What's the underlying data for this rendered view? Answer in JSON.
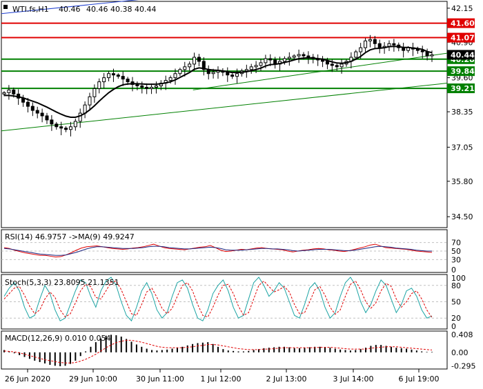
{
  "window": {
    "symbol_label": "WTI.fs,H1",
    "ohlc": [
      "40.46",
      "40.46",
      "40.38",
      "40.44"
    ]
  },
  "colors": {
    "background": "#ffffff",
    "border": "#000000",
    "bull_candle": "#ffffff",
    "bear_candle": "#000000",
    "wick": "#000000",
    "ma": "#000000",
    "resistance": "#e00000",
    "support": "#008000",
    "trendline_blue": "#1f3fcf",
    "trendline_green": "#008000",
    "rsi_line": "#1a237e",
    "rsi_ma": "#e00000",
    "stoch_main": "#1aa3a3",
    "stoch_signal": "#e00000",
    "macd_hist": "#000000",
    "macd_signal": "#e00000",
    "level_box_red": "#e00000",
    "level_box_green": "#008000",
    "current_price_box": "#000000"
  },
  "chart_data": {
    "type": "candlestick",
    "x_ticks": [
      "26 Jun 2020",
      "29 Jun 10:00",
      "30 Jun 11:00",
      "1 Jul 12:00",
      "2 Jul 13:00",
      "3 Jul 14:00",
      "6 Jul 19:00"
    ],
    "price_axis": {
      "ticks": [
        "42.15",
        "40.90",
        "39.60",
        "38.35",
        "37.05",
        "35.80",
        "34.50"
      ],
      "ylim": [
        34.1,
        42.4
      ]
    },
    "levels": [
      {
        "label": "41.60",
        "value": 41.6,
        "kind": "resistance"
      },
      {
        "label": "41.07",
        "value": 41.07,
        "kind": "resistance"
      },
      {
        "label": "40.28",
        "value": 40.28,
        "kind": "support"
      },
      {
        "label": "39.84",
        "value": 39.84,
        "kind": "support"
      },
      {
        "label": "39.21",
        "value": 39.21,
        "kind": "support"
      }
    ],
    "current_price": {
      "label": "40.44",
      "value": 40.44
    },
    "close": [
      39.05,
      39.15,
      39.0,
      38.85,
      38.7,
      38.55,
      38.4,
      38.3,
      38.2,
      38.05,
      37.9,
      37.8,
      37.75,
      37.7,
      37.8,
      38.0,
      38.3,
      38.6,
      38.9,
      39.2,
      39.45,
      39.6,
      39.75,
      39.7,
      39.65,
      39.55,
      39.45,
      39.35,
      39.3,
      39.25,
      39.2,
      39.25,
      39.3,
      39.4,
      39.5,
      39.6,
      39.75,
      39.9,
      40.0,
      40.1,
      40.35,
      40.2,
      39.9,
      39.75,
      39.8,
      39.85,
      39.8,
      39.7,
      39.65,
      39.75,
      39.85,
      39.9,
      40.0,
      40.05,
      40.15,
      40.3,
      40.25,
      40.1,
      40.2,
      40.3,
      40.35,
      40.4,
      40.45,
      40.4,
      40.35,
      40.3,
      40.25,
      40.2,
      40.1,
      40.05,
      40.0,
      40.1,
      40.2,
      40.35,
      40.55,
      40.7,
      40.95,
      41.0,
      40.85,
      40.7,
      40.75,
      40.85,
      40.8,
      40.7,
      40.6,
      40.7,
      40.65,
      40.6,
      40.55,
      40.4,
      40.44
    ],
    "ma_line": [
      38.95,
      38.95,
      38.93,
      38.9,
      38.86,
      38.8,
      38.74,
      38.68,
      38.6,
      38.52,
      38.43,
      38.34,
      38.26,
      38.19,
      38.15,
      38.15,
      38.2,
      38.29,
      38.42,
      38.57,
      38.74,
      38.9,
      39.05,
      39.17,
      39.27,
      39.34,
      39.37,
      39.38,
      39.38,
      39.37,
      39.36,
      39.36,
      39.36,
      39.38,
      39.41,
      39.45,
      39.52,
      39.61,
      39.7,
      39.79,
      39.91,
      39.96,
      39.94,
      39.9,
      39.88,
      39.87,
      39.85,
      39.82,
      39.79,
      39.79,
      39.8,
      39.82,
      39.86,
      39.9,
      39.95,
      40.03,
      40.08,
      40.09,
      40.12,
      40.16,
      40.2,
      40.25,
      40.3,
      40.32,
      40.33,
      40.32,
      40.3,
      40.28,
      40.23,
      40.18,
      40.14,
      40.13,
      40.15,
      40.2,
      40.28,
      40.38,
      40.52,
      40.62,
      40.67,
      40.68,
      40.7,
      40.74,
      40.75,
      40.74,
      40.71,
      40.71,
      40.69,
      40.67,
      40.64,
      40.56,
      40.52
    ],
    "trendlines": [
      {
        "color_key": "trendline_blue",
        "from": [
          0.0,
          41.95
        ],
        "to": [
          0.33,
          42.5
        ]
      },
      {
        "color_key": "trendline_green",
        "from": [
          0.0,
          37.65
        ],
        "to": [
          1.0,
          39.4
        ]
      },
      {
        "color_key": "trendline_green",
        "from": [
          0.43,
          39.15
        ],
        "to": [
          1.0,
          40.5
        ]
      }
    ],
    "rsi": {
      "label": "RSI(14) 46.9757  ->MA(9) 49.9247",
      "levels": [
        "70",
        "50",
        "30",
        "0"
      ],
      "ylim": [
        0,
        100
      ],
      "values": [
        58,
        56,
        52,
        49,
        46,
        44,
        42,
        40,
        40,
        38,
        36,
        37,
        41,
        46,
        52,
        57,
        60,
        61,
        62,
        60,
        58,
        56,
        55,
        54,
        55,
        57,
        58,
        60,
        63,
        66,
        62,
        58,
        56,
        55,
        54,
        53,
        55,
        57,
        59,
        60,
        63,
        58,
        52,
        49,
        50,
        52,
        54,
        53,
        55,
        57,
        58,
        56,
        55,
        54,
        53,
        50,
        48,
        50,
        52,
        53,
        55,
        56,
        55,
        53,
        52,
        50,
        49,
        51,
        54,
        57,
        60,
        64,
        66,
        62,
        58,
        57,
        56,
        55,
        54,
        52,
        50,
        49,
        48,
        47
      ],
      "ma_values": [
        56,
        55,
        53,
        51,
        49,
        47,
        45,
        43,
        42,
        41,
        40,
        40,
        41,
        44,
        47,
        51,
        55,
        58,
        60,
        60,
        59,
        58,
        57,
        56,
        56,
        56,
        57,
        58,
        60,
        61,
        61,
        60,
        58,
        57,
        56,
        55,
        55,
        56,
        57,
        58,
        59,
        58,
        56,
        53,
        52,
        52,
        52,
        53,
        54,
        55,
        56,
        56,
        55,
        55,
        54,
        53,
        51,
        50,
        51,
        52,
        53,
        54,
        54,
        54,
        53,
        52,
        51,
        51,
        52,
        54,
        56,
        58,
        60,
        61,
        60,
        59,
        57,
        56,
        55,
        54,
        52,
        51,
        50,
        50
      ]
    },
    "stoch": {
      "label": "Stoch(5,3,3) 23.8095 21.1351",
      "levels": [
        "100",
        "80",
        "50",
        "20",
        "0"
      ],
      "ylim": [
        0,
        100
      ],
      "values": [
        60,
        75,
        85,
        70,
        40,
        20,
        25,
        55,
        80,
        65,
        35,
        15,
        20,
        45,
        70,
        90,
        85,
        60,
        40,
        70,
        88,
        95,
        80,
        50,
        25,
        15,
        40,
        70,
        85,
        65,
        35,
        20,
        30,
        60,
        85,
        90,
        75,
        45,
        20,
        15,
        35,
        65,
        80,
        90,
        70,
        40,
        20,
        25,
        55,
        85,
        95,
        80,
        60,
        70,
        85,
        75,
        50,
        25,
        20,
        45,
        75,
        85,
        70,
        40,
        20,
        30,
        60,
        85,
        95,
        80,
        50,
        30,
        45,
        70,
        90,
        80,
        55,
        30,
        45,
        70,
        75,
        60,
        35,
        20,
        24
      ],
      "signal_values": [
        55,
        65,
        75,
        78,
        62,
        42,
        28,
        35,
        55,
        68,
        58,
        35,
        22,
        28,
        48,
        70,
        82,
        78,
        58,
        55,
        70,
        86,
        88,
        72,
        50,
        28,
        25,
        45,
        68,
        75,
        58,
        38,
        28,
        38,
        60,
        80,
        85,
        70,
        45,
        25,
        22,
        40,
        62,
        80,
        82,
        65,
        42,
        25,
        30,
        55,
        80,
        88,
        78,
        68,
        72,
        78,
        68,
        45,
        28,
        30,
        50,
        72,
        78,
        62,
        40,
        27,
        35,
        60,
        82,
        88,
        72,
        50,
        38,
        48,
        70,
        84,
        78,
        55,
        40,
        50,
        65,
        70,
        55,
        35,
        21
      ]
    },
    "macd": {
      "label": "MACD(12,26,9) 0.010 0.054",
      "ticks": [
        "0.408",
        "0.00",
        "-0.295"
      ],
      "ylim": [
        -0.36,
        0.46
      ],
      "hist": [
        0.05,
        0.02,
        -0.02,
        -0.06,
        -0.1,
        -0.14,
        -0.18,
        -0.21,
        -0.24,
        -0.27,
        -0.29,
        -0.3,
        -0.29,
        -0.25,
        -0.18,
        -0.08,
        0.02,
        0.12,
        0.22,
        0.3,
        0.36,
        0.38,
        0.37,
        0.34,
        0.29,
        0.23,
        0.17,
        0.12,
        0.08,
        0.05,
        0.04,
        0.05,
        0.06,
        0.08,
        0.1,
        0.12,
        0.15,
        0.18,
        0.2,
        0.21,
        0.22,
        0.18,
        0.12,
        0.07,
        0.04,
        0.03,
        0.02,
        0.02,
        0.03,
        0.05,
        0.07,
        0.09,
        0.1,
        0.11,
        0.12,
        0.12,
        0.11,
        0.09,
        0.09,
        0.1,
        0.11,
        0.12,
        0.12,
        0.11,
        0.1,
        0.08,
        0.06,
        0.05,
        0.04,
        0.05,
        0.07,
        0.1,
        0.14,
        0.16,
        0.16,
        0.14,
        0.12,
        0.1,
        0.09,
        0.08,
        0.06,
        0.04,
        0.02,
        0.01,
        0.01
      ],
      "signal": [
        0.03,
        0.02,
        0.01,
        -0.01,
        -0.04,
        -0.07,
        -0.1,
        -0.13,
        -0.16,
        -0.18,
        -0.2,
        -0.22,
        -0.23,
        -0.23,
        -0.22,
        -0.19,
        -0.15,
        -0.1,
        -0.04,
        0.03,
        0.1,
        0.16,
        0.21,
        0.24,
        0.26,
        0.26,
        0.24,
        0.22,
        0.19,
        0.16,
        0.13,
        0.11,
        0.1,
        0.1,
        0.1,
        0.1,
        0.11,
        0.12,
        0.14,
        0.15,
        0.17,
        0.17,
        0.16,
        0.14,
        0.12,
        0.1,
        0.08,
        0.07,
        0.06,
        0.06,
        0.06,
        0.07,
        0.07,
        0.08,
        0.09,
        0.1,
        0.1,
        0.1,
        0.1,
        0.1,
        0.1,
        0.1,
        0.11,
        0.11,
        0.11,
        0.1,
        0.09,
        0.08,
        0.07,
        0.07,
        0.07,
        0.07,
        0.09,
        0.1,
        0.11,
        0.12,
        0.12,
        0.12,
        0.11,
        0.1,
        0.09,
        0.08,
        0.07,
        0.06,
        0.05
      ]
    }
  }
}
